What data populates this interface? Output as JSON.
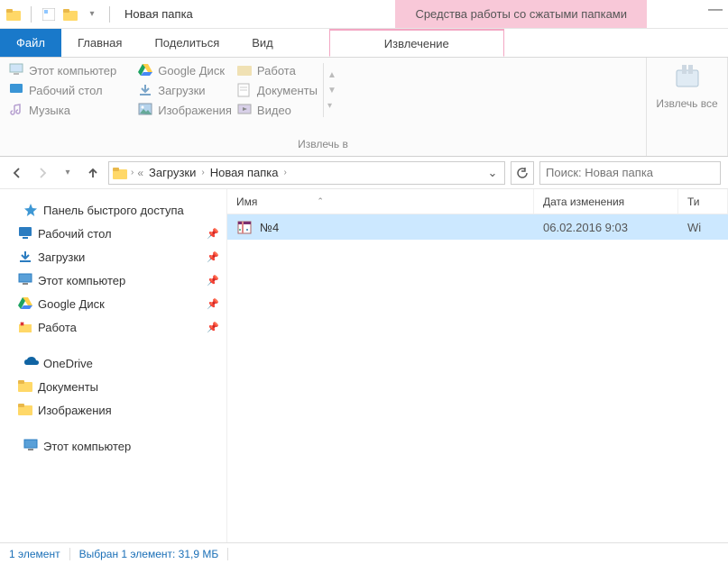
{
  "titlebar": {
    "title": "Новая папка",
    "context_title": "Средства работы со сжатыми папками"
  },
  "tabs": {
    "file": "Файл",
    "home": "Главная",
    "share": "Поделиться",
    "view": "Вид",
    "context": "Извлечение"
  },
  "ribbon": {
    "dest1": "Этот компьютер",
    "dest2": "Рабочий стол",
    "dest3": "Музыка",
    "dest4": "Google Диск",
    "dest5": "Загрузки",
    "dest6": "Изображения",
    "dest7": "Работа",
    "dest8": "Документы",
    "dest9": "Видео",
    "group_label": "Извлечь в",
    "extract_all": "Извлечь все"
  },
  "breadcrumb": {
    "item1": "Загрузки",
    "item2": "Новая папка"
  },
  "search": {
    "placeholder": "Поиск: Новая папка"
  },
  "sidebar": {
    "quick_access": "Панель быстрого доступа",
    "desktop": "Рабочий стол",
    "downloads": "Загрузки",
    "this_pc": "Этот компьютер",
    "gdrive": "Google Диск",
    "work": "Работа",
    "onedrive": "OneDrive",
    "documents": "Документы",
    "pictures": "Изображения",
    "this_pc2": "Этот компьютер"
  },
  "columns": {
    "name": "Имя",
    "date": "Дата изменения",
    "type": "Ти"
  },
  "files": [
    {
      "name": "№4",
      "date": "06.02.2016 9:03",
      "type": "Wi"
    }
  ],
  "status": {
    "count": "1 элемент",
    "selection": "Выбран 1 элемент: 31,9 МБ"
  }
}
